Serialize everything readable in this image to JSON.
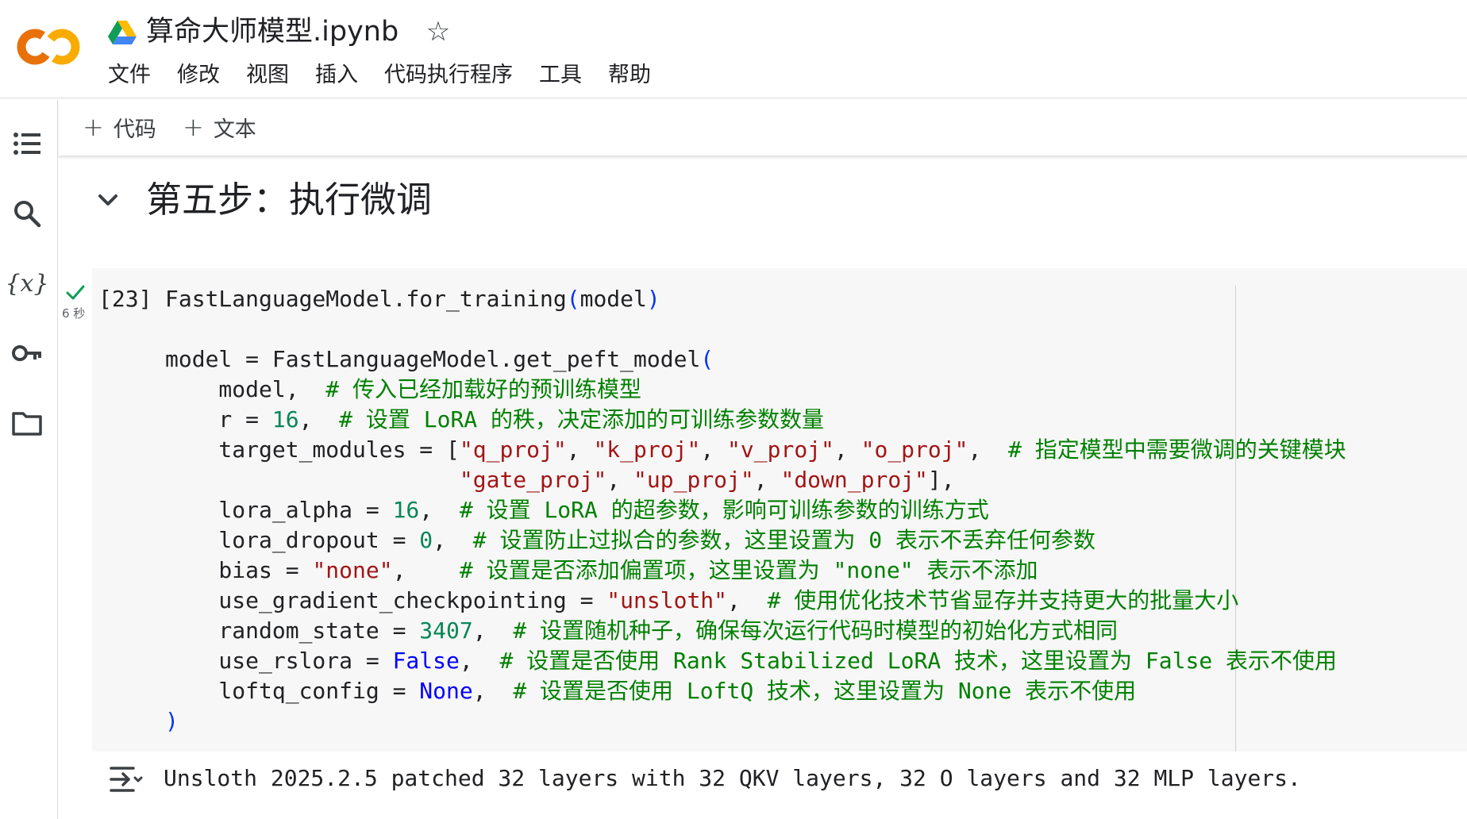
{
  "header": {
    "title": "算命大师模型.ipynb",
    "logo_text": "CO",
    "menu": [
      "文件",
      "修改",
      "视图",
      "插入",
      "代码执行程序",
      "工具",
      "帮助"
    ]
  },
  "left_rail": {
    "icons": [
      "table-of-contents-icon",
      "search-icon",
      "variables-icon",
      "key-icon",
      "folder-icon"
    ],
    "variables_glyph": "{x}"
  },
  "toolbar": {
    "add_code_label": "代码",
    "add_text_label": "文本"
  },
  "section": {
    "title": "第五步：执行微调"
  },
  "cell": {
    "execution_count": "[23]",
    "run_time": "6 秒",
    "status": "success",
    "code_lines": [
      [
        {
          "t": "FastLanguageModel.for_training",
          "c": ""
        },
        {
          "t": "(",
          "c": "paren"
        },
        {
          "t": "model",
          "c": ""
        },
        {
          "t": ")",
          "c": "paren"
        }
      ],
      [],
      [
        {
          "t": "model = FastLanguageModel.get_peft_model",
          "c": ""
        },
        {
          "t": "(",
          "c": "paren"
        }
      ],
      [
        {
          "t": "    model,  ",
          "c": ""
        },
        {
          "t": "# 传入已经加载好的预训练模型",
          "c": "comment"
        }
      ],
      [
        {
          "t": "    r = ",
          "c": ""
        },
        {
          "t": "16",
          "c": "number"
        },
        {
          "t": ",  ",
          "c": ""
        },
        {
          "t": "# 设置 LoRA 的秩，决定添加的可训练参数数量",
          "c": "comment"
        }
      ],
      [
        {
          "t": "    target_modules = [",
          "c": ""
        },
        {
          "t": "\"q_proj\"",
          "c": "string"
        },
        {
          "t": ", ",
          "c": ""
        },
        {
          "t": "\"k_proj\"",
          "c": "string"
        },
        {
          "t": ", ",
          "c": ""
        },
        {
          "t": "\"v_proj\"",
          "c": "string"
        },
        {
          "t": ", ",
          "c": ""
        },
        {
          "t": "\"o_proj\"",
          "c": "string"
        },
        {
          "t": ",  ",
          "c": ""
        },
        {
          "t": "# 指定模型中需要微调的关键模块",
          "c": "comment"
        }
      ],
      [
        {
          "t": "                      ",
          "c": ""
        },
        {
          "t": "\"gate_proj\"",
          "c": "string"
        },
        {
          "t": ", ",
          "c": ""
        },
        {
          "t": "\"up_proj\"",
          "c": "string"
        },
        {
          "t": ", ",
          "c": ""
        },
        {
          "t": "\"down_proj\"",
          "c": "string"
        },
        {
          "t": "],",
          "c": ""
        }
      ],
      [
        {
          "t": "    lora_alpha = ",
          "c": ""
        },
        {
          "t": "16",
          "c": "number"
        },
        {
          "t": ",  ",
          "c": ""
        },
        {
          "t": "# 设置 LoRA 的超参数，影响可训练参数的训练方式",
          "c": "comment"
        }
      ],
      [
        {
          "t": "    lora_dropout = ",
          "c": ""
        },
        {
          "t": "0",
          "c": "number"
        },
        {
          "t": ",  ",
          "c": ""
        },
        {
          "t": "# 设置防止过拟合的参数，这里设置为 0 表示不丢弃任何参数",
          "c": "comment"
        }
      ],
      [
        {
          "t": "    bias = ",
          "c": ""
        },
        {
          "t": "\"none\"",
          "c": "string"
        },
        {
          "t": ",    ",
          "c": ""
        },
        {
          "t": "# 设置是否添加偏置项，这里设置为 \"none\" 表示不添加",
          "c": "comment"
        }
      ],
      [
        {
          "t": "    use_gradient_checkpointing = ",
          "c": ""
        },
        {
          "t": "\"unsloth\"",
          "c": "string"
        },
        {
          "t": ",  ",
          "c": ""
        },
        {
          "t": "# 使用优化技术节省显存并支持更大的批量大小",
          "c": "comment"
        }
      ],
      [
        {
          "t": "    random_state = ",
          "c": ""
        },
        {
          "t": "3407",
          "c": "number"
        },
        {
          "t": ",  ",
          "c": ""
        },
        {
          "t": "# 设置随机种子，确保每次运行代码时模型的初始化方式相同",
          "c": "comment"
        }
      ],
      [
        {
          "t": "    use_rslora = ",
          "c": ""
        },
        {
          "t": "False",
          "c": "keyword"
        },
        {
          "t": ",  ",
          "c": ""
        },
        {
          "t": "# 设置是否使用 Rank Stabilized LoRA 技术，这里设置为 False 表示不使用",
          "c": "comment"
        }
      ],
      [
        {
          "t": "    loftq_config = ",
          "c": ""
        },
        {
          "t": "None",
          "c": "keyword"
        },
        {
          "t": ",  ",
          "c": ""
        },
        {
          "t": "# 设置是否使用 LoftQ 技术，这里设置为 None 表示不使用",
          "c": "comment"
        }
      ],
      [
        {
          "t": ")",
          "c": "paren"
        }
      ]
    ]
  },
  "output": {
    "text": "Unsloth 2025.2.5 patched 32 layers with 32 QKV layers, 32 O layers and 32 MLP layers."
  },
  "colors": {
    "comment": "#008000",
    "string": "#a31515",
    "number": "#098658",
    "keyword": "#0000ff",
    "logo_orange": "#f9ab00",
    "logo_dark_orange": "#e8710a",
    "success_check": "#0f9d58"
  }
}
